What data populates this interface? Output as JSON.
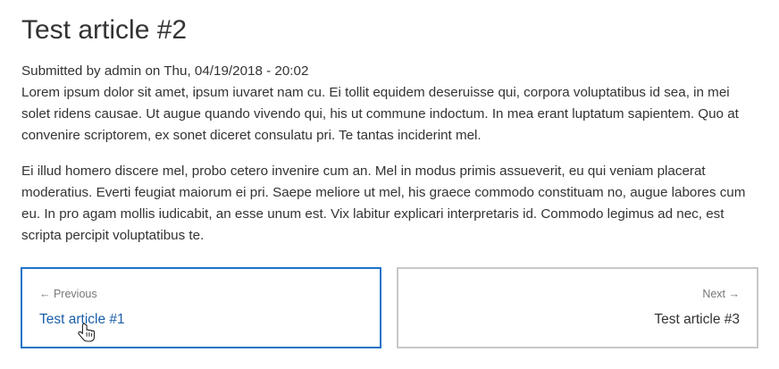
{
  "article": {
    "title": "Test article #2",
    "submitted": "Submitted by admin on Thu, 04/19/2018 - 20:02",
    "paragraphs": [
      "Lorem ipsum dolor sit amet, ipsum iuvaret nam cu. Ei tollit equidem deseruisse qui, corpora voluptatibus id sea, in mei solet ridens causae. Ut augue quando vivendo qui, his ut commune indoctum. In mea erant luptatum sapientem. Quo at convenire scriptorem, ex sonet diceret consulatu pri. Te tantas inciderint mel.",
      "Ei illud homero discere mel, probo cetero invenire cum an. Mel in modus primis assueverit, eu qui veniam placerat moderatius. Everti feugiat maiorum ei pri. Saepe meliore ut mel, his graece commodo constituam no, augue labores cum eu. In pro agam mollis iudicabit, an esse unum est. Vix labitur explicari interpretaris id. Commodo legimus ad nec, est scripta percipit voluptatibus te."
    ]
  },
  "pager": {
    "previous_label": "← Previous",
    "previous_title": "Test article #1",
    "next_label": "Next →",
    "next_title": "Test article #3"
  },
  "colors": {
    "active_border": "#1a73c8",
    "link": "#1a5ea8",
    "border": "#c8c8c8"
  },
  "icons": {
    "cursor": "hand-pointer-icon"
  }
}
